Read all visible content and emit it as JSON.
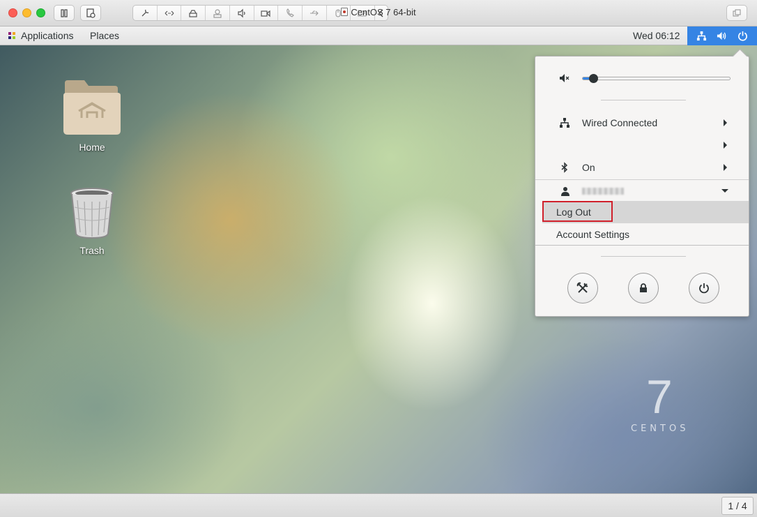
{
  "window": {
    "title": "CentOS 7 64-bit"
  },
  "topbar": {
    "applications_label": "Applications",
    "places_label": "Places",
    "clock": "Wed 06:12"
  },
  "desktop": {
    "icons": [
      {
        "label": "Home",
        "icon": "home-folder-icon"
      },
      {
        "label": "Trash",
        "icon": "trash-can-icon"
      }
    ],
    "branding": {
      "numeral": "7",
      "word": "CENTOS"
    }
  },
  "system_menu": {
    "volume": {
      "level": 0.07,
      "icon": "speaker-muted-icon"
    },
    "network": {
      "label": "Wired Connected",
      "icon": "wired-network-icon"
    },
    "empty_row": {
      "label": ""
    },
    "bluetooth": {
      "label": "On",
      "icon": "bluetooth-icon"
    },
    "user": {
      "icon": "user-icon"
    },
    "user_submenu": {
      "logout_label": "Log Out",
      "account_settings_label": "Account Settings"
    },
    "buttons": [
      {
        "name": "settings",
        "icon": "tools-icon"
      },
      {
        "name": "lock",
        "icon": "lock-icon"
      },
      {
        "name": "power",
        "icon": "power-icon"
      }
    ],
    "accent_color": "#3584e4",
    "highlight_color": "#d0202b"
  },
  "statusbar": {
    "page_counter": "1 / 4"
  }
}
